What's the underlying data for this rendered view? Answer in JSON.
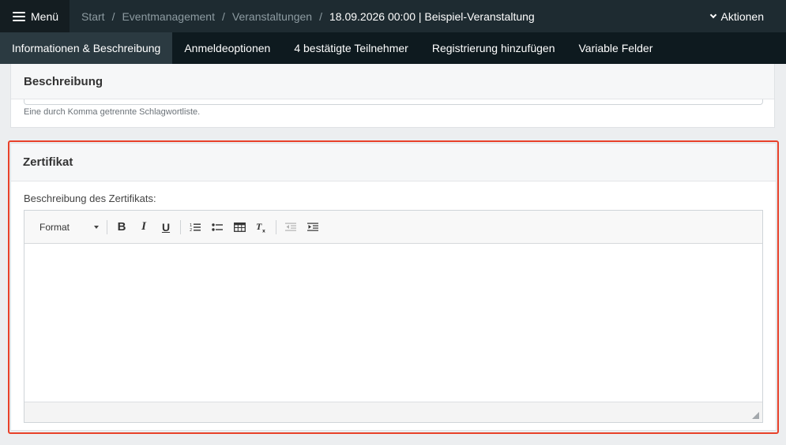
{
  "topbar": {
    "menu_label": "Menü",
    "breadcrumb": [
      "Start",
      "Eventmanagement",
      "Veranstaltungen",
      "18.09.2026 00:00 | Beispiel-Veranstaltung"
    ],
    "separator": "/",
    "actions_label": "Aktionen"
  },
  "tabs": [
    {
      "label": "Informationen & Beschreibung",
      "active": true
    },
    {
      "label": "Anmeldeoptionen",
      "active": false
    },
    {
      "label": "4 bestätigte Teilnehmer",
      "active": false
    },
    {
      "label": "Registrierung hinzufügen",
      "active": false
    },
    {
      "label": "Variable Felder",
      "active": false
    }
  ],
  "description_panel": {
    "title": "Beschreibung",
    "hint": "Eine durch Komma getrennte Schlagwortliste."
  },
  "certificate_panel": {
    "title": "Zertifikat",
    "field_label": "Beschreibung des Zertifikats:",
    "editor": {
      "format_label": "Format",
      "content": ""
    }
  },
  "colors": {
    "topbar": "#1e2b31",
    "tabbar": "#0e1a1f",
    "active_tab": "#2b3a41",
    "highlight": "#e8412a"
  }
}
